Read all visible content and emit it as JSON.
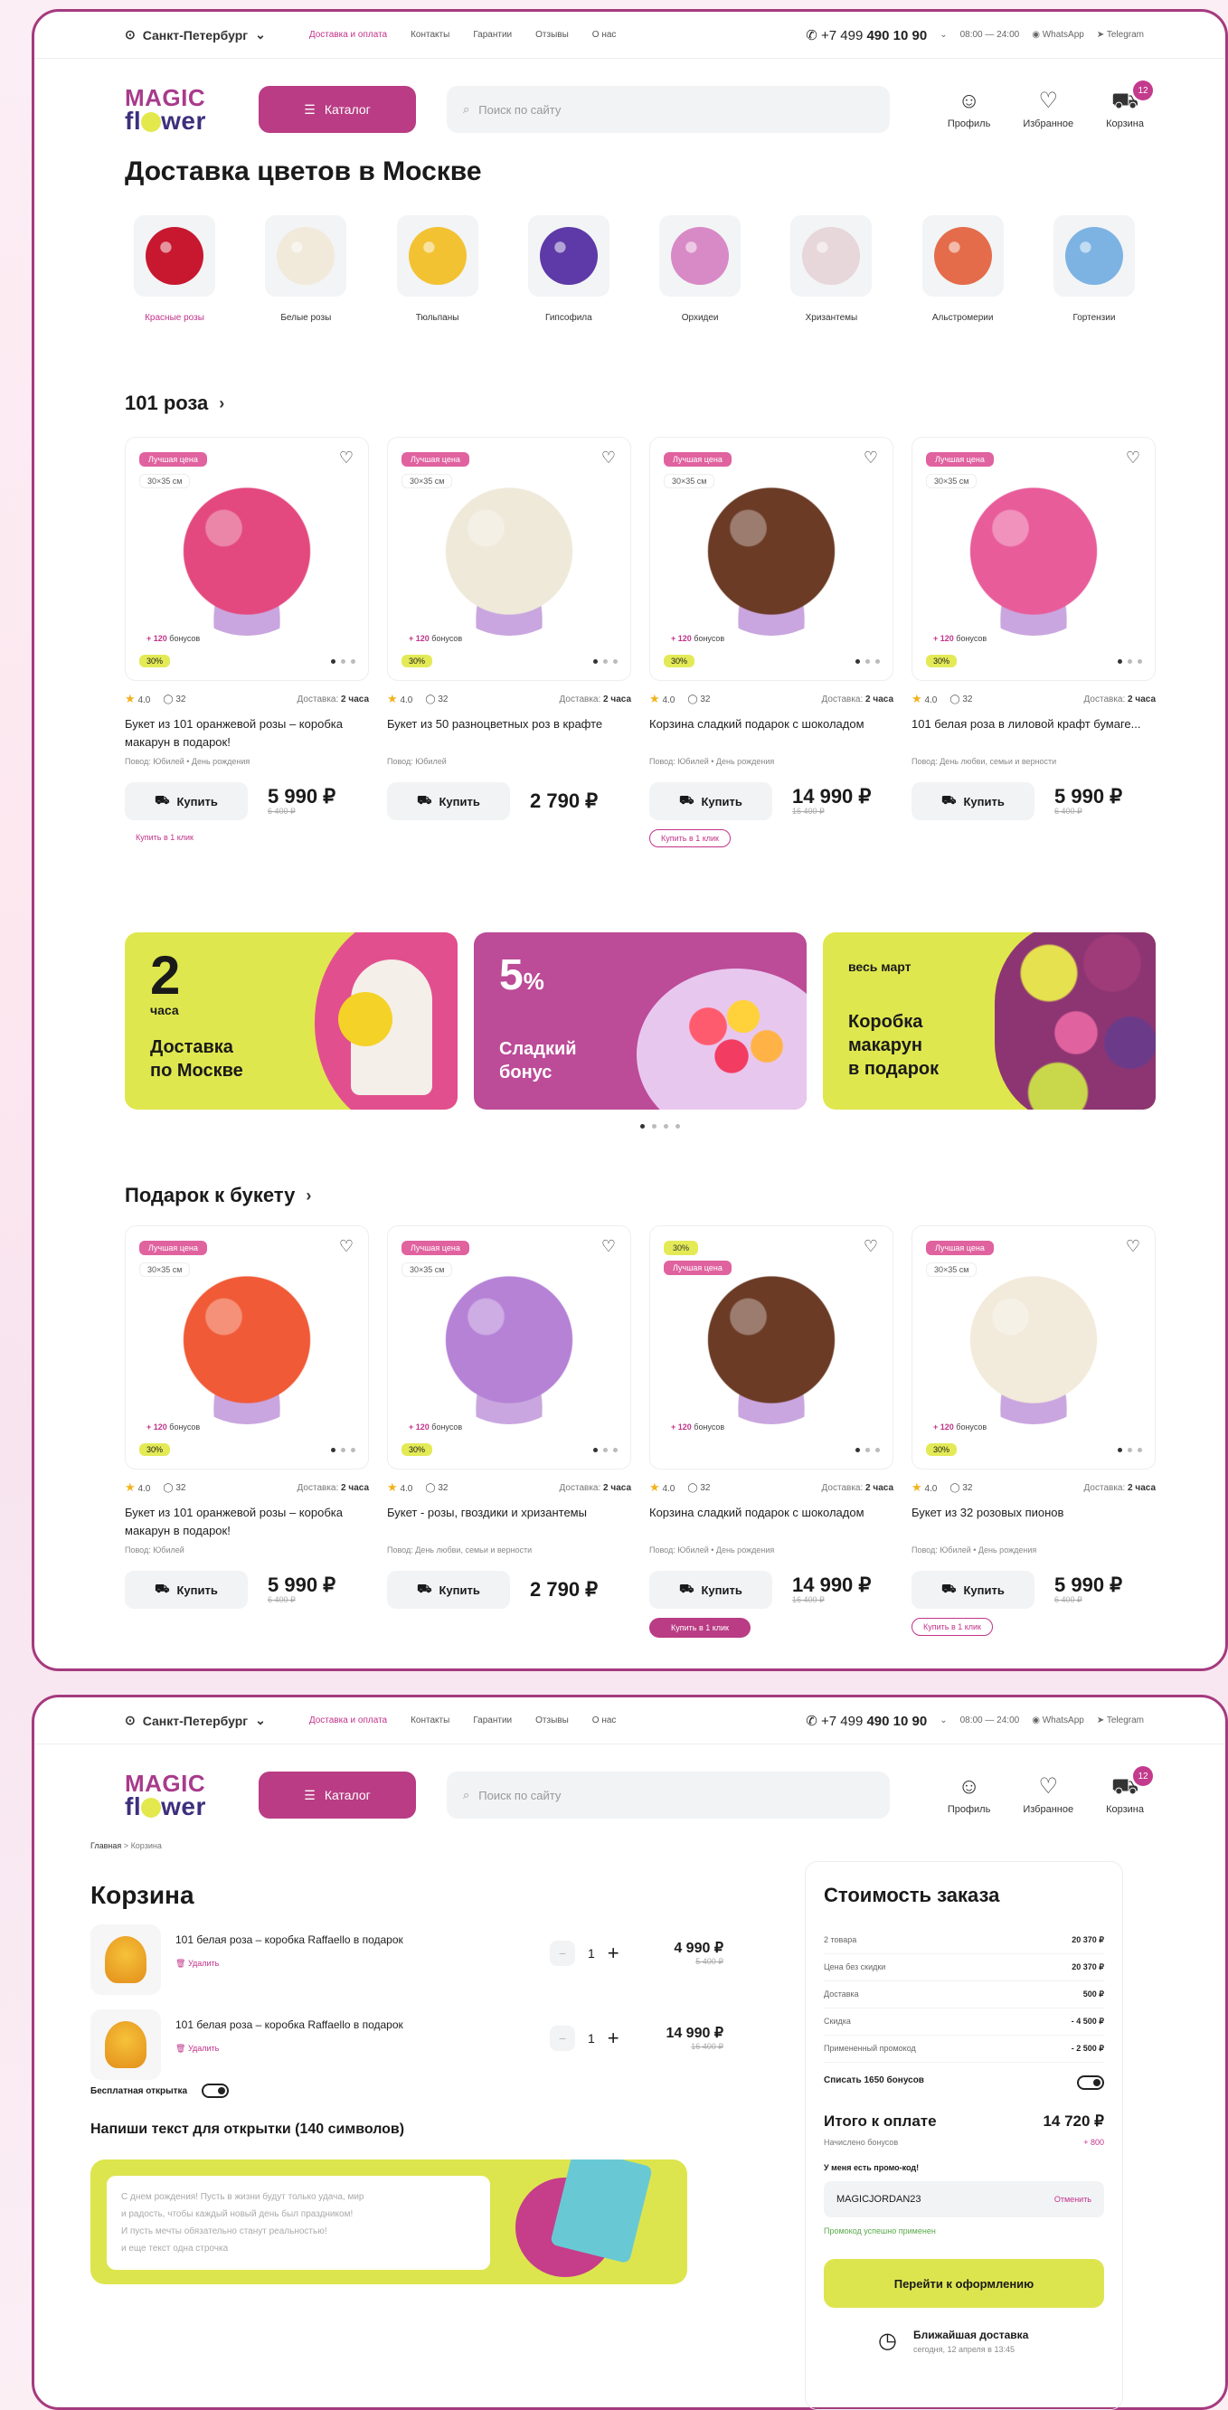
{
  "topbar": {
    "city": "Санкт-Петербург",
    "nav": [
      "Доставка и оплата",
      "Контакты",
      "Гарантии",
      "Отзывы",
      "О нас"
    ],
    "phone_prefix": "+7 499",
    "phone_number": "490 10 90",
    "hours": "08:00 — 24:00",
    "whatsapp": "WhatsApp",
    "telegram": "Telegram"
  },
  "topbar2": {
    "city": "Санкт-Петербург",
    "nav": [
      "Доставка и оплата",
      "Контакты",
      "Гарантии",
      "Отзывы",
      "О нас"
    ],
    "phone_prefix": "+7 499",
    "phone_number": "490 10 90",
    "hours": "08:00 — 24:00",
    "whatsapp": "WhatsApp",
    "telegram": "Telegram"
  },
  "header": {
    "logo_line1": "MAGIC",
    "logo_line2_a": "fl",
    "logo_line2_b": "wer",
    "catalog": "Каталог",
    "search_placeholder": "Поиск по сайту",
    "profile": "Профиль",
    "favorites": "Избранное",
    "cart": "Корзина",
    "cart_count": "12"
  },
  "page_title": "Доставка цветов в Москве",
  "categories": [
    {
      "label": "Красные розы",
      "color": "#c8182f"
    },
    {
      "label": "Белые розы",
      "color": "#f1eadb"
    },
    {
      "label": "Тюльпаны",
      "color": "#f3c233"
    },
    {
      "label": "Гипсофила",
      "color": "#5d3aa8"
    },
    {
      "label": "Орхидеи",
      "color": "#d88ac6"
    },
    {
      "label": "Хризантемы",
      "color": "#e7d6da"
    },
    {
      "label": "Альстромерии",
      "color": "#e56c4a"
    },
    {
      "label": "Гортензии",
      "color": "#7db3e3"
    }
  ],
  "section1": {
    "title": "101 роза",
    "cards": [
      {
        "best": "Лучшая цена",
        "size": "30×35 см",
        "bonus": "+ 120",
        "bonus_txt": "бонусов",
        "pct": "30%",
        "rating": "4.0",
        "reviews": "32",
        "del_label": "Доставка:",
        "del_time": "2 часа",
        "name": "Букет из 101 оранжевой розы – коробка макарун в подарок!",
        "occ": "Повод: Юбилей • День рождения",
        "buy": "Купить",
        "price": "5 990 ₽",
        "old": "6 400 ₽",
        "oneclick": "Купить в 1 клик",
        "color": "#e3497e"
      },
      {
        "best": "Лучшая цена",
        "size": "30×35 см",
        "bonus": "+ 120",
        "bonus_txt": "бонусов",
        "pct": "30%",
        "rating": "4.0",
        "reviews": "32",
        "del_label": "Доставка:",
        "del_time": "2 часа",
        "name": "Букет из 50 разноцветных роз в крафте",
        "occ": "Повод: Юбилей",
        "buy": "Купить",
        "price": "2 790 ₽",
        "old": "",
        "oneclick": "",
        "color": "#efe9da"
      },
      {
        "best": "Лучшая цена",
        "size": "30×35 см",
        "bonus": "+ 120",
        "bonus_txt": "бонусов",
        "pct": "30%",
        "rating": "4.0",
        "reviews": "32",
        "del_label": "Доставка:",
        "del_time": "2 часа",
        "name": "Корзина сладкий подарок с шоколадом",
        "occ": "Повод: Юбилей • День рождения",
        "buy": "Купить",
        "price": "14 990 ₽",
        "old": "16 400 ₽",
        "oneclick": "Купить в 1 клик",
        "color": "#6b3b26"
      },
      {
        "best": "Лучшая цена",
        "size": "30×35 см",
        "bonus": "+ 120",
        "bonus_txt": "бонусов",
        "pct": "30%",
        "rating": "4.0",
        "reviews": "32",
        "del_label": "Доставка:",
        "del_time": "2 часа",
        "name": "101 белая роза в лиловой крафт бумаге...",
        "occ": "Повод: День любви, семьи и верности",
        "buy": "Купить",
        "price": "5 990 ₽",
        "old": "6 400 ₽",
        "oneclick": "",
        "color": "#e85c9a"
      }
    ]
  },
  "banners": [
    {
      "big": "2",
      "small": "часа",
      "line1": "Доставка",
      "line2": "по Москве"
    },
    {
      "big": "5",
      "small": "%",
      "line1": "Сладкий",
      "line2": "бонус"
    },
    {
      "top": "весь март",
      "line1": "Коробка",
      "line2": "макарун",
      "line3": "в подарок"
    }
  ],
  "section2": {
    "title": "Подарок к букету",
    "cards": [
      {
        "best": "Лучшая цена",
        "size": "30×35 см",
        "bonus": "+ 120",
        "bonus_txt": "бонусов",
        "pct": "30%",
        "rating": "4.0",
        "reviews": "32",
        "del_label": "Доставка:",
        "del_time": "2 часа",
        "name": "Букет из 101 оранжевой розы – коробка макарун в подарок!",
        "occ": "Повод: Юбилей",
        "buy": "Купить",
        "price": "5 990 ₽",
        "old": "6 400 ₽",
        "oneclick": "",
        "color": "#f05a36"
      },
      {
        "best": "Лучшая цена",
        "size": "30×35 см",
        "bonus": "+ 120",
        "bonus_txt": "бонусов",
        "pct": "30%",
        "rating": "4.0",
        "reviews": "32",
        "del_label": "Доставка:",
        "del_time": "2 часа",
        "name": "Букет - розы, гвоздики и хризантемы",
        "occ": "Повод: День любви, семьи и верности",
        "buy": "Купить",
        "price": "2 790 ₽",
        "old": "",
        "oneclick": "",
        "color": "#b582d6"
      },
      {
        "best": "Лучшая цена",
        "size": "30%",
        "bonus": "+ 120",
        "bonus_txt": "бонусов",
        "pct": "",
        "rating": "4.0",
        "reviews": "32",
        "del_label": "Доставка:",
        "del_time": "2 часа",
        "name": "Корзина сладкий подарок с шоколадом",
        "occ": "Повод: Юбилей • День рождения",
        "buy": "Купить",
        "price": "14 990 ₽",
        "old": "16 400 ₽",
        "oneclick": "Купить в 1 клик",
        "color": "#6b3b26"
      },
      {
        "best": "Лучшая цена",
        "size": "30×35 см",
        "bonus": "+ 120",
        "bonus_txt": "бонусов",
        "pct": "30%",
        "rating": "4.0",
        "reviews": "32",
        "del_label": "Доставка:",
        "del_time": "2 часа",
        "name": "Букет из 32 розовых пионов",
        "occ": "Повод: Юбилей • День рождения",
        "buy": "Купить",
        "price": "5 990 ₽",
        "old": "6 400 ₽",
        "oneclick": "Купить в 1 клик",
        "color": "#f2eada"
      }
    ]
  },
  "cart": {
    "breadcrumb_home": "Главная",
    "breadcrumb_sep": ">",
    "breadcrumb_current": "Корзина",
    "title": "Корзина",
    "items": [
      {
        "name": "101 белая роза – коробка Raffaello в подарок",
        "delete": "Удалить",
        "qty": "1",
        "price": "4 990 ₽",
        "old": "5 400 ₽"
      },
      {
        "name": "101 белая роза – коробка Raffaello в подарок",
        "delete": "Удалить",
        "qty": "1",
        "price": "14 990 ₽",
        "old": "16 400 ₽"
      }
    ],
    "free_card": "Бесплатная открытка",
    "note_title": "Напиши текст для открытки (140 символов)",
    "note_line1": "С днем рождения! Пусть в жизни будут только удача, мир",
    "note_line2": "и радость, чтобы каждый новый день был праздником!",
    "note_line3": "И пусть мечты обязательно станут реальностью!",
    "note_line4": "и еще текст одна строчка"
  },
  "summary": {
    "title": "Стоимость заказа",
    "rows": [
      {
        "label": "2 товара",
        "value": "20 370 ₽"
      },
      {
        "label": "Цена без скидки",
        "value": "20 370 ₽"
      },
      {
        "label": "Доставка",
        "value": "500 ₽"
      },
      {
        "label": "Скидка",
        "value": "- 4 500 ₽"
      },
      {
        "label": "Примененный промокод",
        "value": "- 2 500 ₽"
      }
    ],
    "bonus_write_off": "Списать 1650 бонусов",
    "total_label": "Итого к оплате",
    "total_value": "14 720 ₽",
    "accrued_label": "Начислено бонусов",
    "accrued_value": "+ 800",
    "promo_label": "У меня есть промо-код!",
    "promo_code": "MAGICJORDAN23",
    "promo_cancel": "Отменить",
    "promo_ok": "Промокод успешно применен",
    "checkout": "Перейти к оформлению",
    "nearest": "Ближайшая доставка",
    "nearest_when": "сегодня, 12 апреля в 13:45"
  },
  "colors": {
    "accent": "#b93c84",
    "lime": "#dde54e",
    "pink": "#e0629f"
  }
}
